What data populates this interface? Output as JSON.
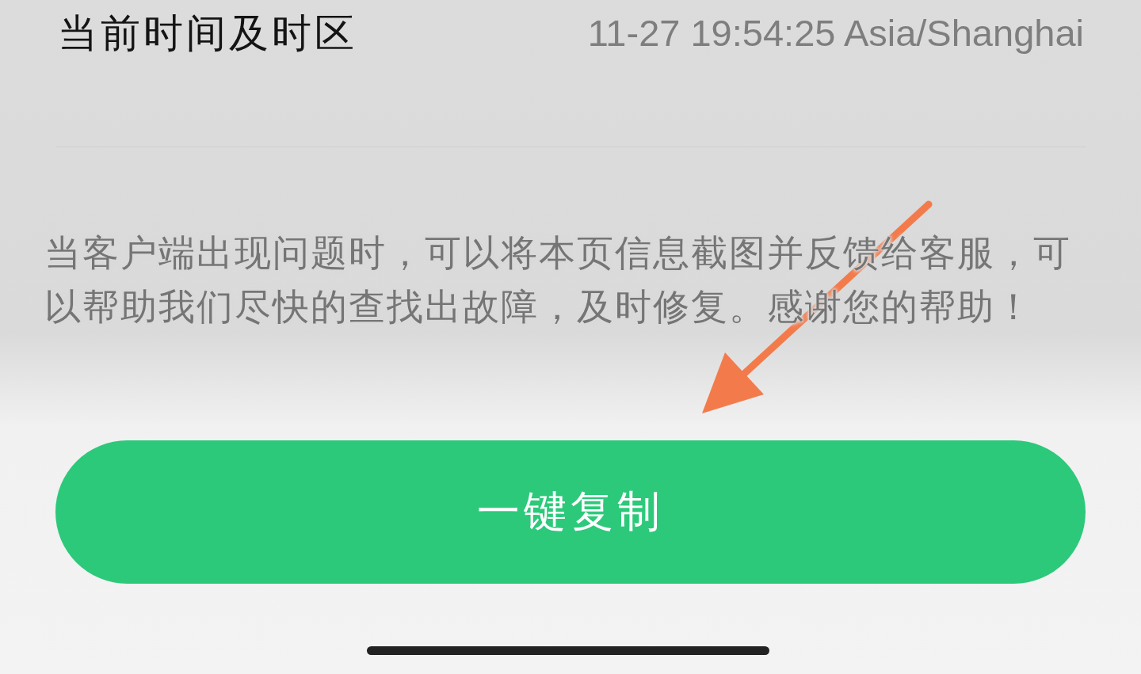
{
  "info_row": {
    "label": "当前时间及时区",
    "value": "11-27 19:54:25 Asia/Shanghai"
  },
  "notice": "当客户端出现问题时，可以将本页信息截图并反馈给客服，可以帮助我们尽快的查找出故障，及时修复。感谢您的帮助！",
  "copy_button": {
    "label": "一键复制"
  }
}
